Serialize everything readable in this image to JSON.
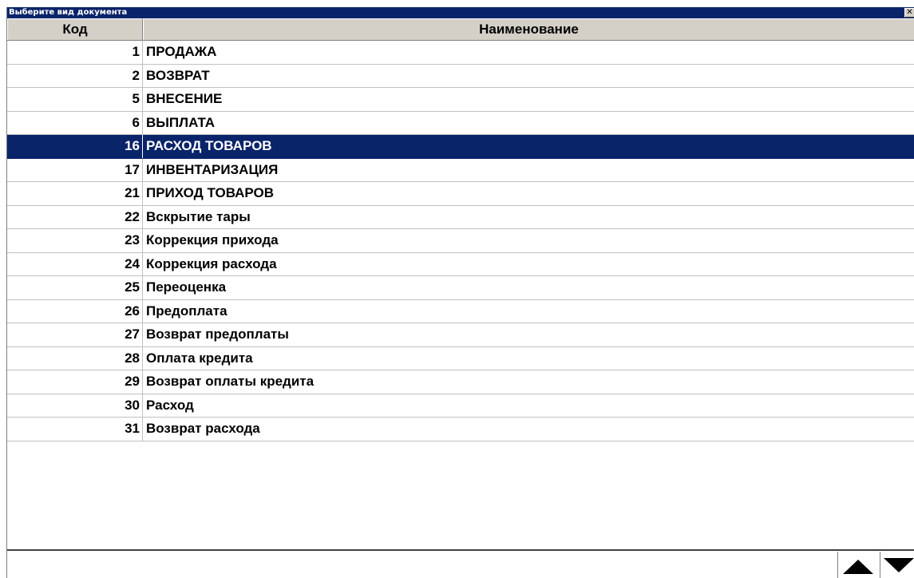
{
  "window": {
    "title": "Выберите вид документа",
    "close_glyph": "✕"
  },
  "table": {
    "columns": [
      "Код",
      "Наименование"
    ],
    "selected_index": 4,
    "rows": [
      {
        "code": "1",
        "name": "ПРОДАЖА"
      },
      {
        "code": "2",
        "name": "ВОЗВРАТ"
      },
      {
        "code": "5",
        "name": "ВНЕСЕНИЕ"
      },
      {
        "code": "6",
        "name": "ВЫПЛАТА"
      },
      {
        "code": "16",
        "name": "РАСХОД ТОВАРОВ"
      },
      {
        "code": "17",
        "name": "ИНВЕНТАРИЗАЦИЯ"
      },
      {
        "code": "21",
        "name": "ПРИХОД ТОВАРОВ"
      },
      {
        "code": "22",
        "name": "Вскрытие тары"
      },
      {
        "code": "23",
        "name": "Коррекция прихода"
      },
      {
        "code": "24",
        "name": "Коррекция расхода"
      },
      {
        "code": "25",
        "name": "Переоценка"
      },
      {
        "code": "26",
        "name": "Предоплата"
      },
      {
        "code": "27",
        "name": "Возврат предоплаты"
      },
      {
        "code": "28",
        "name": "Оплата кредита"
      },
      {
        "code": "29",
        "name": "Возврат оплаты кредита"
      },
      {
        "code": "30",
        "name": "Расход"
      },
      {
        "code": "31",
        "name": "Возврат расхода"
      }
    ]
  },
  "bottom": {
    "input_value": "",
    "scroll_up_icon": "arrow-up-icon",
    "scroll_down_icon": "arrow-down-icon"
  },
  "colors": {
    "title_bg": "#0a246a",
    "selected_bg": "#0a246a",
    "header_bg": "#d4d0c8"
  }
}
